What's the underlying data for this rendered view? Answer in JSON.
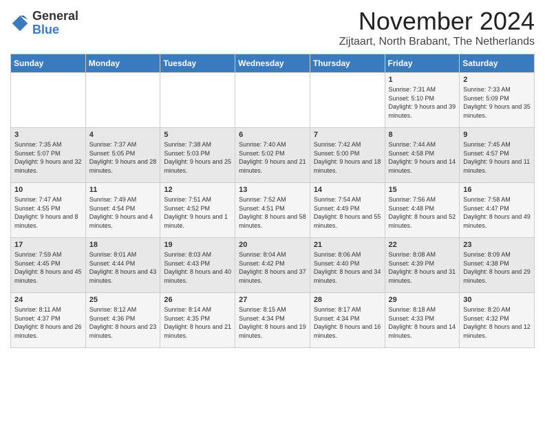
{
  "logo": {
    "general": "General",
    "blue": "Blue"
  },
  "header": {
    "month_year": "November 2024",
    "location": "Zijtaart, North Brabant, The Netherlands"
  },
  "days_of_week": [
    "Sunday",
    "Monday",
    "Tuesday",
    "Wednesday",
    "Thursday",
    "Friday",
    "Saturday"
  ],
  "weeks": [
    [
      {
        "day": "",
        "info": ""
      },
      {
        "day": "",
        "info": ""
      },
      {
        "day": "",
        "info": ""
      },
      {
        "day": "",
        "info": ""
      },
      {
        "day": "",
        "info": ""
      },
      {
        "day": "1",
        "info": "Sunrise: 7:31 AM\nSunset: 5:10 PM\nDaylight: 9 hours and 39 minutes."
      },
      {
        "day": "2",
        "info": "Sunrise: 7:33 AM\nSunset: 5:09 PM\nDaylight: 9 hours and 35 minutes."
      }
    ],
    [
      {
        "day": "3",
        "info": "Sunrise: 7:35 AM\nSunset: 5:07 PM\nDaylight: 9 hours and 32 minutes."
      },
      {
        "day": "4",
        "info": "Sunrise: 7:37 AM\nSunset: 5:05 PM\nDaylight: 9 hours and 28 minutes."
      },
      {
        "day": "5",
        "info": "Sunrise: 7:38 AM\nSunset: 5:03 PM\nDaylight: 9 hours and 25 minutes."
      },
      {
        "day": "6",
        "info": "Sunrise: 7:40 AM\nSunset: 5:02 PM\nDaylight: 9 hours and 21 minutes."
      },
      {
        "day": "7",
        "info": "Sunrise: 7:42 AM\nSunset: 5:00 PM\nDaylight: 9 hours and 18 minutes."
      },
      {
        "day": "8",
        "info": "Sunrise: 7:44 AM\nSunset: 4:58 PM\nDaylight: 9 hours and 14 minutes."
      },
      {
        "day": "9",
        "info": "Sunrise: 7:45 AM\nSunset: 4:57 PM\nDaylight: 9 hours and 11 minutes."
      }
    ],
    [
      {
        "day": "10",
        "info": "Sunrise: 7:47 AM\nSunset: 4:55 PM\nDaylight: 9 hours and 8 minutes."
      },
      {
        "day": "11",
        "info": "Sunrise: 7:49 AM\nSunset: 4:54 PM\nDaylight: 9 hours and 4 minutes."
      },
      {
        "day": "12",
        "info": "Sunrise: 7:51 AM\nSunset: 4:52 PM\nDaylight: 9 hours and 1 minute."
      },
      {
        "day": "13",
        "info": "Sunrise: 7:52 AM\nSunset: 4:51 PM\nDaylight: 8 hours and 58 minutes."
      },
      {
        "day": "14",
        "info": "Sunrise: 7:54 AM\nSunset: 4:49 PM\nDaylight: 8 hours and 55 minutes."
      },
      {
        "day": "15",
        "info": "Sunrise: 7:56 AM\nSunset: 4:48 PM\nDaylight: 8 hours and 52 minutes."
      },
      {
        "day": "16",
        "info": "Sunrise: 7:58 AM\nSunset: 4:47 PM\nDaylight: 8 hours and 49 minutes."
      }
    ],
    [
      {
        "day": "17",
        "info": "Sunrise: 7:59 AM\nSunset: 4:45 PM\nDaylight: 8 hours and 45 minutes."
      },
      {
        "day": "18",
        "info": "Sunrise: 8:01 AM\nSunset: 4:44 PM\nDaylight: 8 hours and 43 minutes."
      },
      {
        "day": "19",
        "info": "Sunrise: 8:03 AM\nSunset: 4:43 PM\nDaylight: 8 hours and 40 minutes."
      },
      {
        "day": "20",
        "info": "Sunrise: 8:04 AM\nSunset: 4:42 PM\nDaylight: 8 hours and 37 minutes."
      },
      {
        "day": "21",
        "info": "Sunrise: 8:06 AM\nSunset: 4:40 PM\nDaylight: 8 hours and 34 minutes."
      },
      {
        "day": "22",
        "info": "Sunrise: 8:08 AM\nSunset: 4:39 PM\nDaylight: 8 hours and 31 minutes."
      },
      {
        "day": "23",
        "info": "Sunrise: 8:09 AM\nSunset: 4:38 PM\nDaylight: 8 hours and 29 minutes."
      }
    ],
    [
      {
        "day": "24",
        "info": "Sunrise: 8:11 AM\nSunset: 4:37 PM\nDaylight: 8 hours and 26 minutes."
      },
      {
        "day": "25",
        "info": "Sunrise: 8:12 AM\nSunset: 4:36 PM\nDaylight: 8 hours and 23 minutes."
      },
      {
        "day": "26",
        "info": "Sunrise: 8:14 AM\nSunset: 4:35 PM\nDaylight: 8 hours and 21 minutes."
      },
      {
        "day": "27",
        "info": "Sunrise: 8:15 AM\nSunset: 4:34 PM\nDaylight: 8 hours and 19 minutes."
      },
      {
        "day": "28",
        "info": "Sunrise: 8:17 AM\nSunset: 4:34 PM\nDaylight: 8 hours and 16 minutes."
      },
      {
        "day": "29",
        "info": "Sunrise: 8:18 AM\nSunset: 4:33 PM\nDaylight: 8 hours and 14 minutes."
      },
      {
        "day": "30",
        "info": "Sunrise: 8:20 AM\nSunset: 4:32 PM\nDaylight: 8 hours and 12 minutes."
      }
    ]
  ]
}
